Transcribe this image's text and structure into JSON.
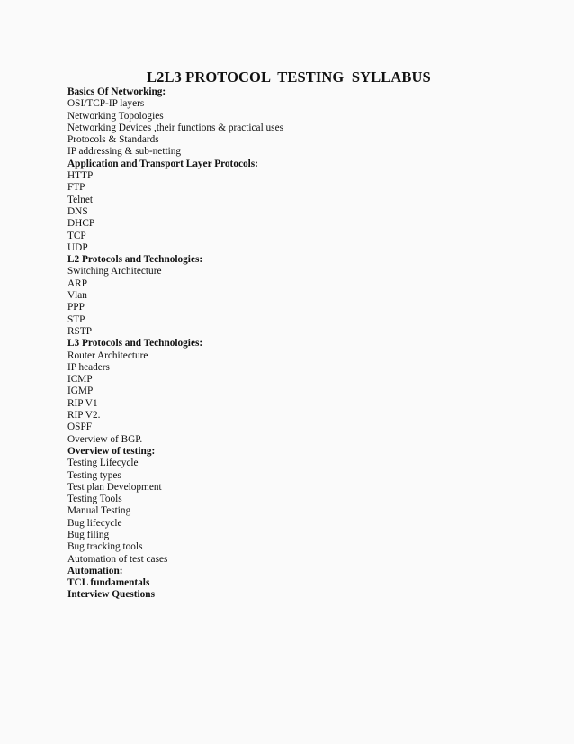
{
  "document": {
    "title": "L2L3 PROTOCOL  TESTING  SYLLABUS",
    "sections": [
      {
        "heading": "Basics Of Networking:",
        "items": [
          "OSI/TCP-IP layers",
          "Networking Topologies",
          "Networking Devices ,their functions & practical uses",
          "Protocols & Standards",
          "IP addressing & sub-netting"
        ]
      },
      {
        "heading": "Application and Transport Layer Protocols:",
        "items": [
          "HTTP",
          "FTP",
          "Telnet",
          "DNS",
          "DHCP",
          "TCP",
          "UDP"
        ]
      },
      {
        "heading": "L2 Protocols and Technologies:",
        "items": [
          "Switching Architecture",
          "ARP",
          "Vlan",
          "PPP",
          "STP",
          "RSTP"
        ]
      },
      {
        "heading": "L3 Protocols and Technologies:",
        "items": [
          "Router Architecture",
          "IP headers",
          "ICMP",
          "IGMP",
          "RIP V1",
          "RIP V2.",
          "OSPF",
          "Overview of BGP."
        ]
      },
      {
        "heading": "Overview of testing:",
        "items": [
          "Testing Lifecycle",
          "Testing types",
          "Test plan Development",
          "Testing Tools",
          "Manual Testing",
          "Bug lifecycle",
          "Bug filing",
          "Bug tracking tools",
          "Automation of test cases"
        ]
      },
      {
        "heading": "Automation:",
        "items": []
      },
      {
        "heading": "TCL fundamentals",
        "items": []
      },
      {
        "heading": "Interview Questions",
        "items": []
      }
    ]
  }
}
